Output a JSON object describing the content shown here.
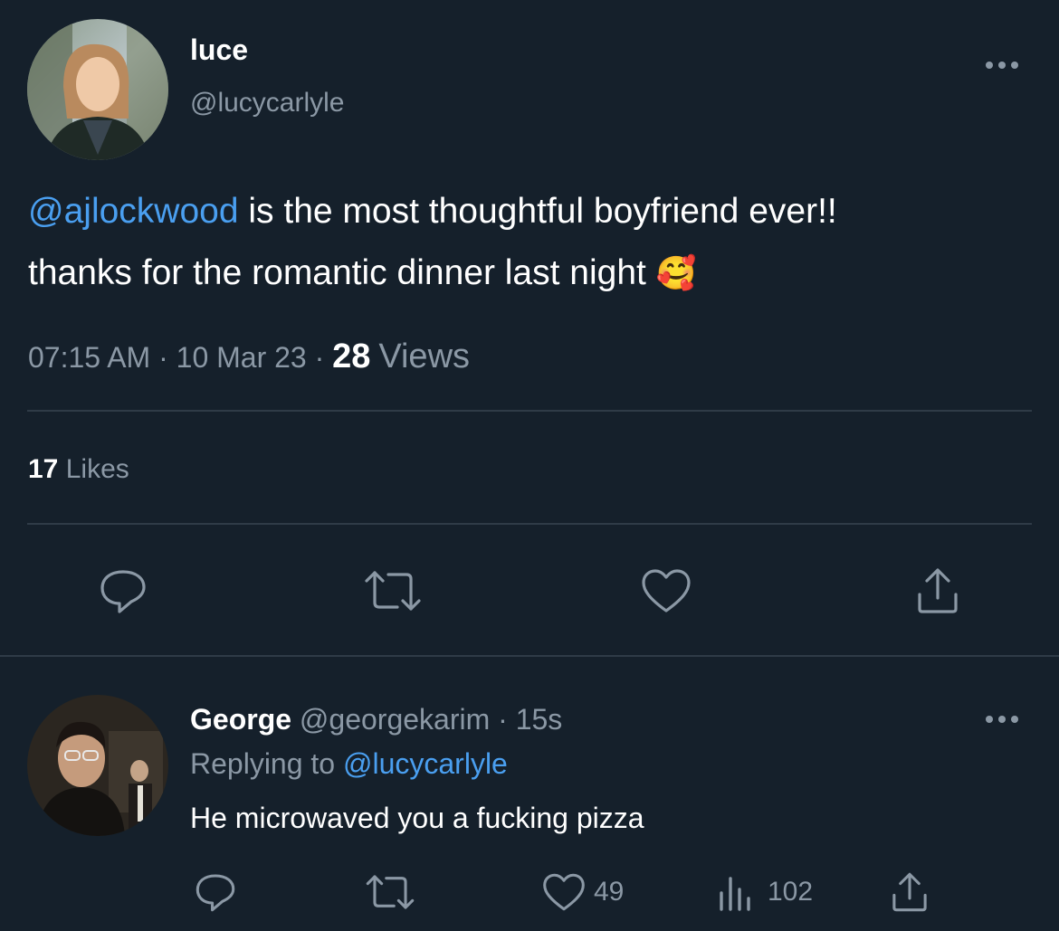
{
  "tweet": {
    "author_name": "luce",
    "author_handle": "@lucycarlyle",
    "mention": "@ajlockwood",
    "text_line1_rest": " is the most thoughtful boyfriend ever!!",
    "text_line2": "thanks for the romantic dinner last night",
    "emoji": "🥰",
    "time": "07:15 AM",
    "sep1": "·",
    "date": "10 Mar 23",
    "sep2": "·",
    "views_count": "28",
    "views_label": "Views",
    "likes_count": "17",
    "likes_label": "Likes"
  },
  "reply": {
    "author_name": "George",
    "author_handle": "@georgekarim",
    "sep": "·",
    "time": "15s",
    "replying_label": "Replying to",
    "replying_handle": "@lucycarlyle",
    "text": "He microwaved you a fucking pizza",
    "likes": "49",
    "views": "102"
  },
  "icons": {
    "more": "more-icon",
    "reply": "reply-icon",
    "retweet": "retweet-icon",
    "like": "heart-icon",
    "share": "share-icon",
    "analytics": "analytics-icon"
  },
  "colors": {
    "background": "#15202b",
    "link": "#4a9ff0",
    "muted": "#8b98a5",
    "divider": "#2f3b47"
  }
}
